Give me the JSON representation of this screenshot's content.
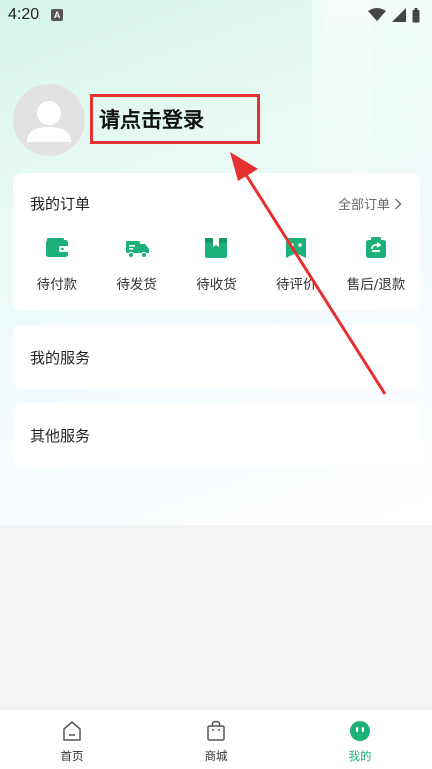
{
  "status_bar": {
    "time": "4:20",
    "indicator": "A",
    "icons": [
      "wifi-icon",
      "signal-icon",
      "battery-icon"
    ]
  },
  "profile": {
    "login_prompt": "请点击登录",
    "avatar_icon": "default-avatar-icon"
  },
  "orders": {
    "title": "我的订单",
    "all_orders_label": "全部订单",
    "items": [
      {
        "label": "待付款",
        "icon": "wallet-icon"
      },
      {
        "label": "待发货",
        "icon": "delivery-truck-icon"
      },
      {
        "label": "待收货",
        "icon": "package-box-icon"
      },
      {
        "label": "待评价",
        "icon": "review-flag-icon"
      },
      {
        "label": "售后/退款",
        "icon": "refund-bag-icon"
      }
    ]
  },
  "my_services": {
    "title": "我的服务"
  },
  "other_services": {
    "title": "其他服务"
  },
  "bottom_nav": {
    "items": [
      {
        "label": "首页",
        "icon": "home-icon"
      },
      {
        "label": "商城",
        "icon": "shopping-bag-icon"
      },
      {
        "label": "我的",
        "icon": "profile-face-icon",
        "active": true
      }
    ]
  },
  "colors": {
    "accent": "#1db079",
    "highlight_box": "#e5312f",
    "annotation_arrow": "#e5312f"
  }
}
